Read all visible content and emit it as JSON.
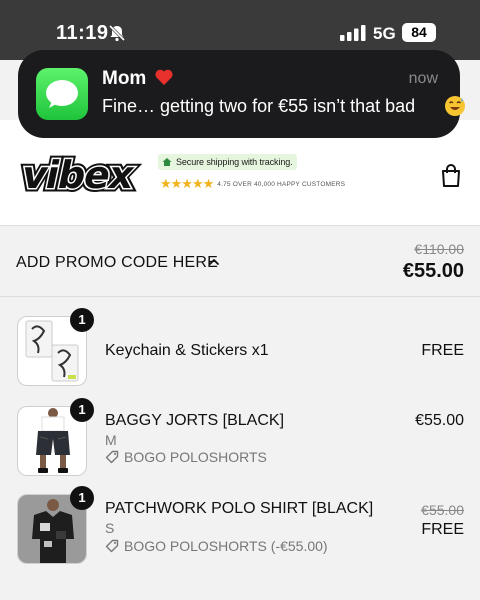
{
  "status_bar": {
    "time": "11:19",
    "network": "5G",
    "battery": "84"
  },
  "notification": {
    "sender": "Mom",
    "time": "now",
    "message": "Fine… getting two for €55 isn’t that bad",
    "app_icon": "messages-icon"
  },
  "header": {
    "logo_text": "vibex",
    "shipping_badge": "Secure shipping with tracking.",
    "rating": "4.75 OVER 40,000 HAPPY CUSTOMERS",
    "rating_stars": 4.75
  },
  "promo": {
    "label": "ADD PROMO CODE HERE",
    "original_total": "€110.00",
    "total": "€55.00"
  },
  "items": [
    {
      "qty": "1",
      "name": "Keychain & Stickers x1",
      "variant": "",
      "discount": "",
      "price_old": "",
      "price": "FREE"
    },
    {
      "qty": "1",
      "name": "BAGGY JORTS [BLACK]",
      "variant": "M",
      "discount": "BOGO POLOSHORTS",
      "price_old": "",
      "price": "€55.00"
    },
    {
      "qty": "1",
      "name": "PATCHWORK POLO SHIRT [BLACK]",
      "variant": "S",
      "discount": "BOGO POLOSHORTS (-€55.00)",
      "price_old": "€55.00",
      "price": "FREE"
    }
  ],
  "colors": {
    "accent_green": "#34c759",
    "star_gold": "#f1b21d",
    "notification_bg": "#1b1b1d"
  }
}
